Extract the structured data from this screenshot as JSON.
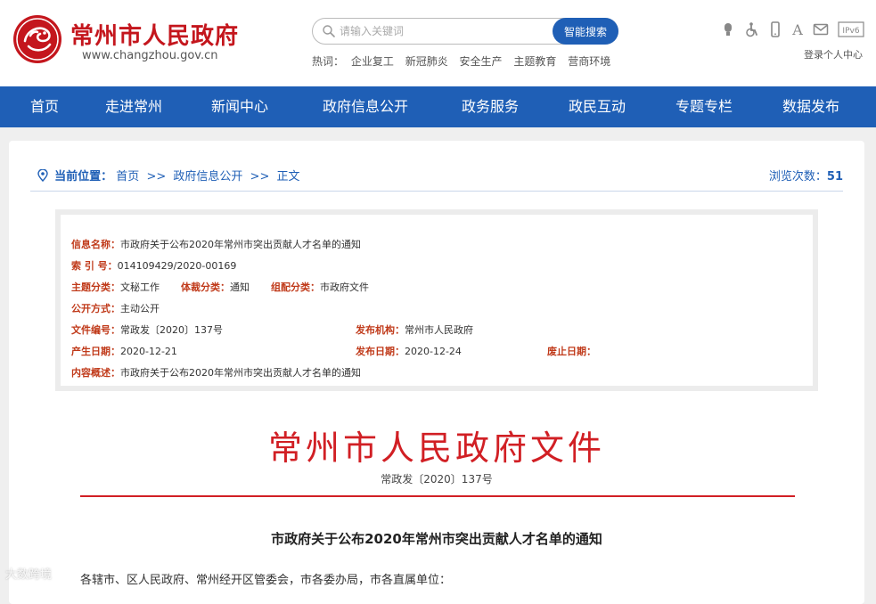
{
  "header": {
    "site_title": "常州市人民政府",
    "site_url": "www.changzhou.gov.cn",
    "brand_color": "#c4161d"
  },
  "search": {
    "placeholder": "请输入关键词",
    "button_label": "智能搜索"
  },
  "hot": {
    "label": "热词：",
    "links": [
      "企业复工",
      "新冠肺炎",
      "安全生产",
      "主题教育",
      "营商环境"
    ]
  },
  "tools": {
    "icons": [
      "speaker-icon",
      "accessibility-icon",
      "mobile-icon",
      "font-size-icon",
      "mail-icon",
      "ipv6-icon"
    ],
    "ipv6_text": "IPv6",
    "font_text": "A",
    "login_label": "登录个人中心"
  },
  "nav": {
    "accent": "#1f5fb6",
    "items": [
      "首页",
      "走进常州",
      "新闻中心",
      "政府信息公开",
      "政务服务",
      "政民互动",
      "专题专栏",
      "数据发布"
    ]
  },
  "breadcrumb": {
    "label": "当前位置：",
    "items": [
      "首页",
      "政府信息公开",
      "正文"
    ],
    "separator": ">>",
    "views_label": "浏览次数：",
    "views_count": "51"
  },
  "meta": {
    "info_name_label": "信息名称：",
    "info_name": "市政府关于公布2020年常州市突出贡献人才名单的通知",
    "index_label": "索 引 号：",
    "index": "014109429/2020-00169",
    "topic_label": "主题分类：",
    "topic": "文秘工作",
    "genre_label": "体裁分类：",
    "genre": "通知",
    "org_cat_label": "组配分类：",
    "org_cat": "市政府文件",
    "public_label": "公开方式：",
    "public": "主动公开",
    "doc_no_label": "文件编号：",
    "doc_no": "常政发〔2020〕137号",
    "issuer_label": "发布机构：",
    "issuer": "常州市人民政府",
    "created_label": "产生日期：",
    "created": "2020-12-21",
    "published_label": "发布日期：",
    "published": "2020-12-24",
    "expire_label": "废止日期：",
    "expire": "",
    "summary_label": "内容概述：",
    "summary": "市政府关于公布2020年常州市突出贡献人才名单的通知"
  },
  "document": {
    "masthead": "常州市人民政府文件",
    "number": "常政发〔2020〕137号",
    "title": "市政府关于公布2020年常州市突出贡献人才名单的通知",
    "body_first_line": "各辖市、区人民政府、常州经开区管委会，市各委办局，市各直属单位：",
    "masthead_color": "#d11f24"
  },
  "watermark": "大数跨境"
}
